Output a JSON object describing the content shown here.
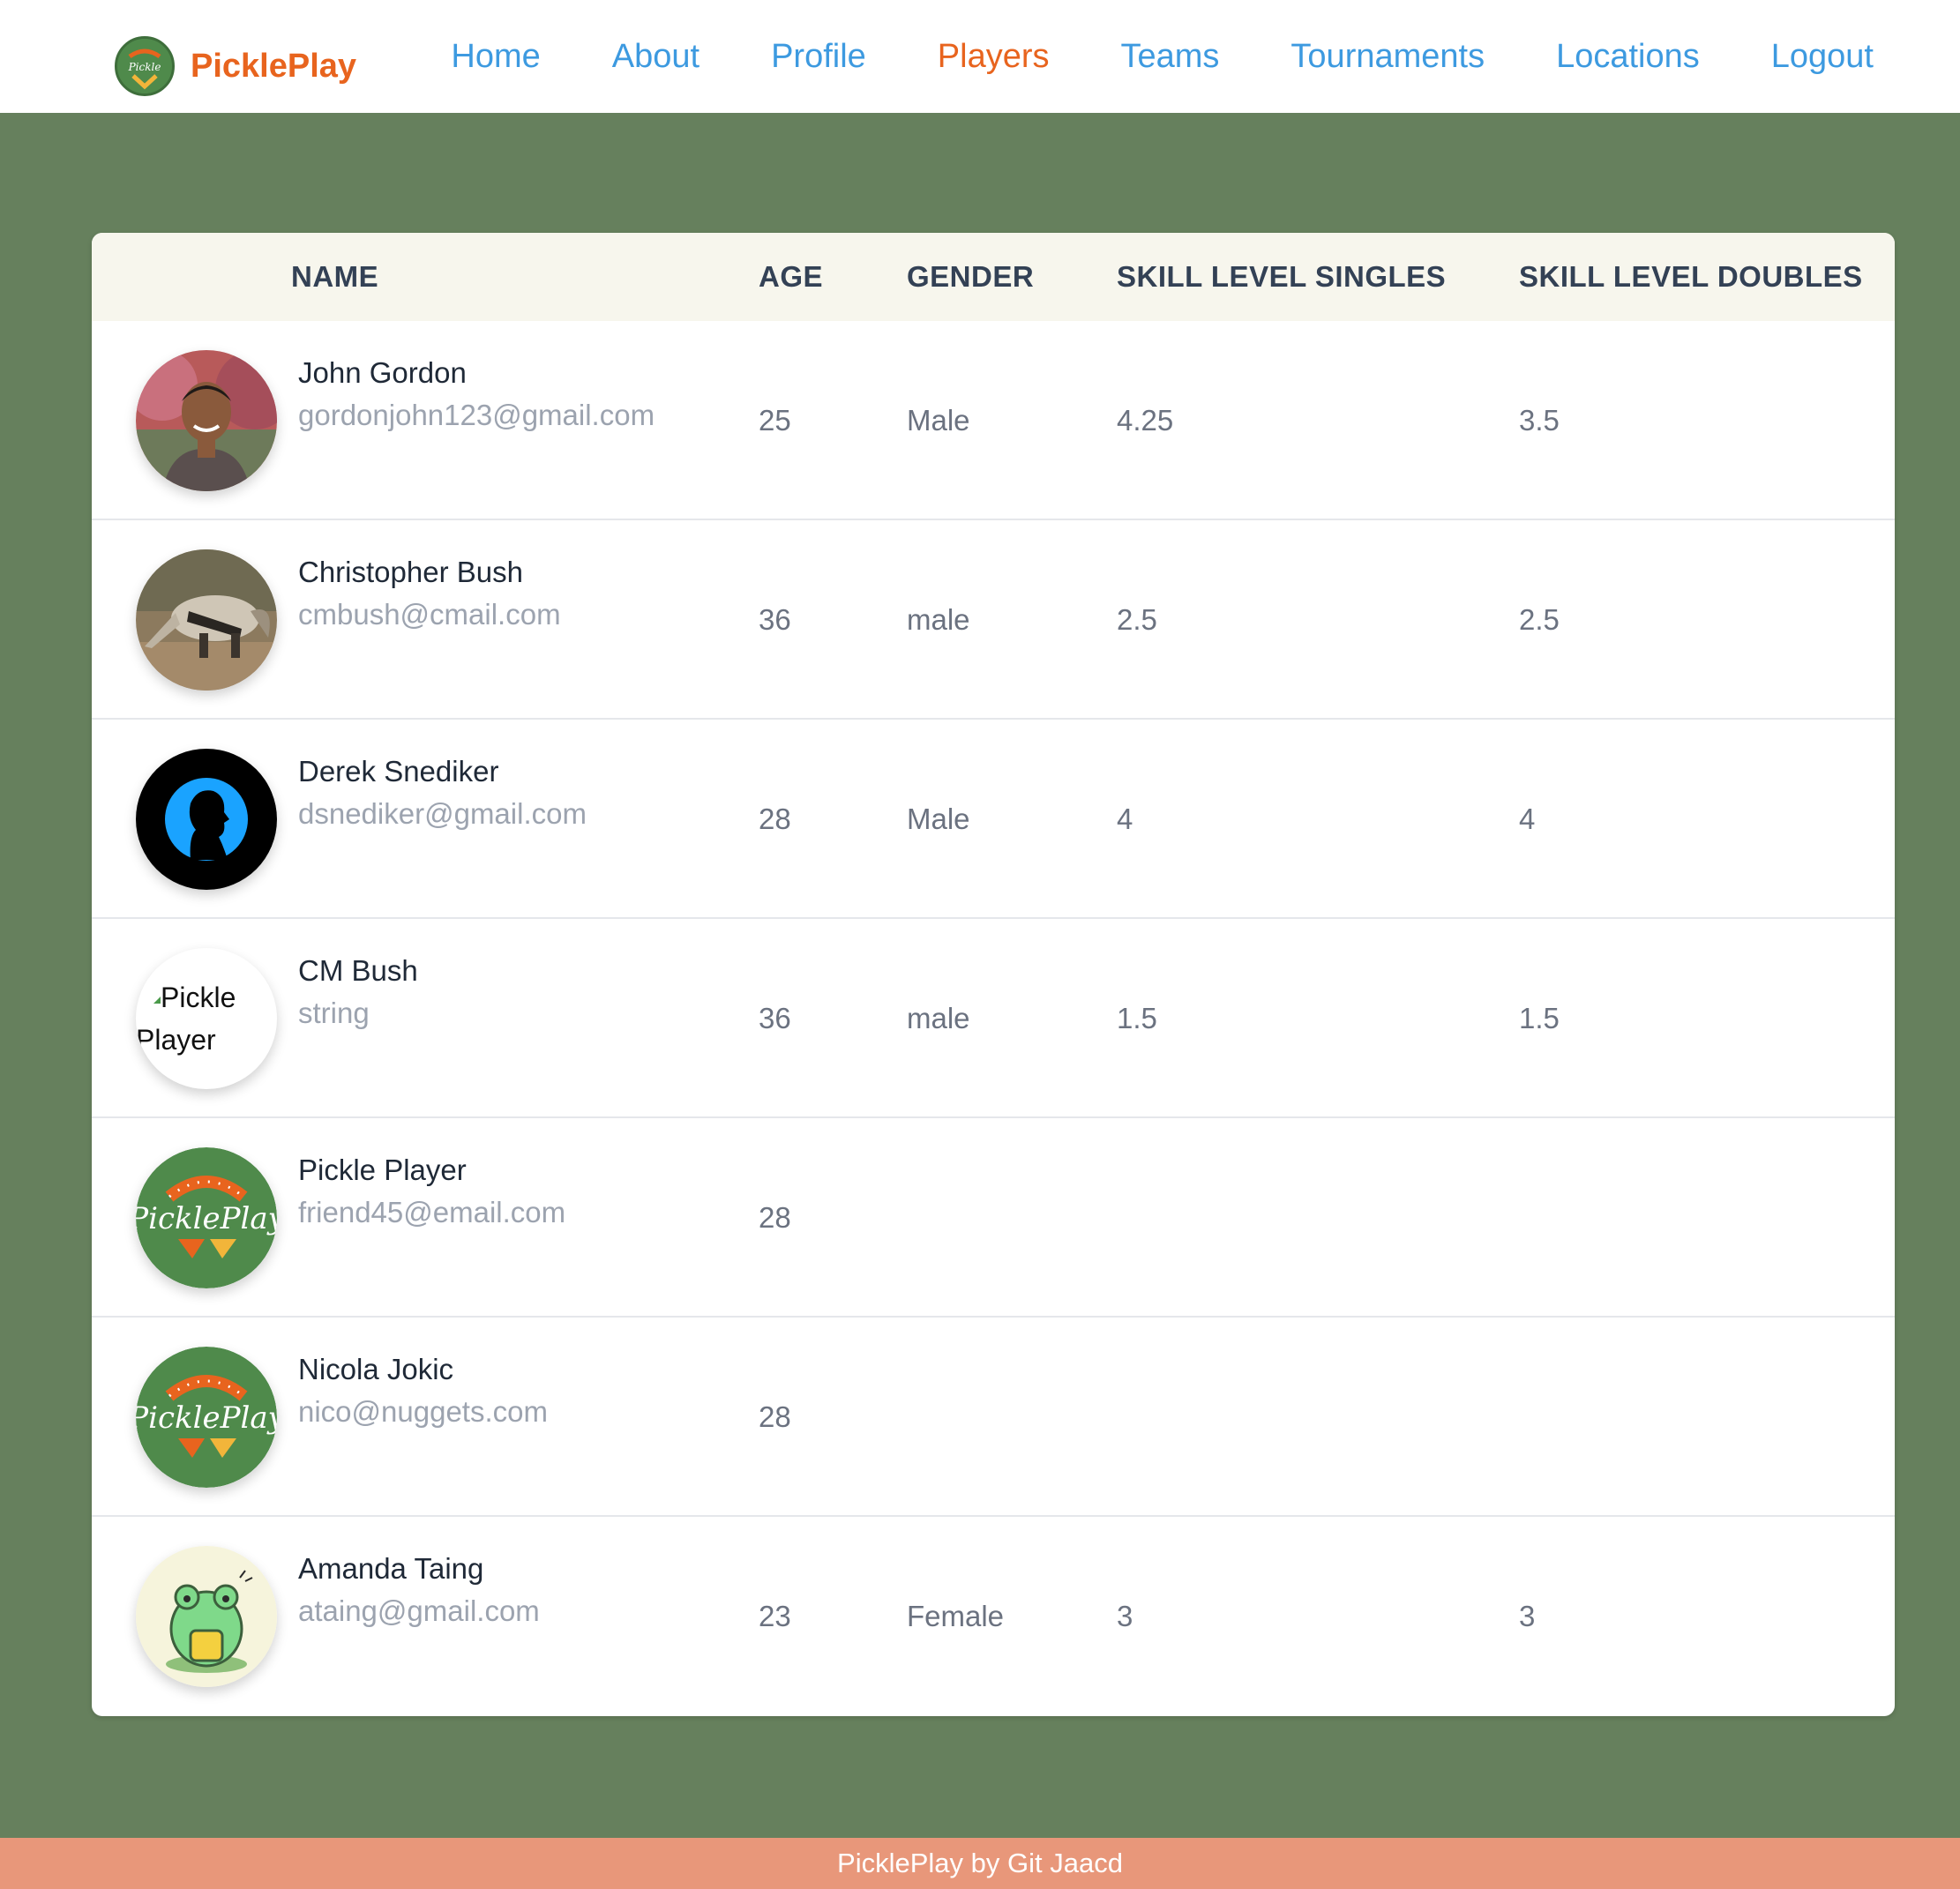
{
  "brand": {
    "name": "PicklePlay",
    "logo_icon": "pickleplay-logo-icon"
  },
  "nav": {
    "links": [
      {
        "label": "Home",
        "active": false
      },
      {
        "label": "About",
        "active": false
      },
      {
        "label": "Profile",
        "active": false
      },
      {
        "label": "Players",
        "active": true
      },
      {
        "label": "Teams",
        "active": false
      },
      {
        "label": "Tournaments",
        "active": false
      },
      {
        "label": "Locations",
        "active": false
      },
      {
        "label": "Logout",
        "active": false
      }
    ]
  },
  "table": {
    "headers": {
      "name": "NAME",
      "age": "AGE",
      "gender": "GENDER",
      "singles": "SKILL LEVEL SINGLES",
      "doubles": "SKILL LEVEL DOUBLES"
    },
    "rows": [
      {
        "name": "John Gordon",
        "email": "gordonjohn123@gmail.com",
        "age": "25",
        "gender": "Male",
        "singles": "4.25",
        "doubles": "3.5",
        "avatar": "photo-man-avatar"
      },
      {
        "name": "Christopher Bush",
        "email": "cmbush@cmail.com",
        "age": "36",
        "gender": "male",
        "singles": "2.5",
        "doubles": "2.5",
        "avatar": "anteater-avatar"
      },
      {
        "name": "Derek Snediker",
        "email": "dsnediker@gmail.com",
        "age": "28",
        "gender": "Male",
        "singles": "4",
        "doubles": "4",
        "avatar": "silhouette-avatar"
      },
      {
        "name": "CM Bush",
        "email": "string",
        "age": "36",
        "gender": "male",
        "singles": "1.5",
        "doubles": "1.5",
        "avatar": "broken-image-avatar",
        "alt_text": "Pickle Player"
      },
      {
        "name": "Pickle Player",
        "email": "friend45@email.com",
        "age": "28",
        "gender": "",
        "singles": "",
        "doubles": "",
        "avatar": "pickleplay-logo-avatar"
      },
      {
        "name": "Nicola Jokic",
        "email": "nico@nuggets.com",
        "age": "28",
        "gender": "",
        "singles": "",
        "doubles": "",
        "avatar": "pickleplay-logo-avatar"
      },
      {
        "name": "Amanda Taing",
        "email": "ataing@gmail.com",
        "age": "23",
        "gender": "Female",
        "singles": "3",
        "doubles": "3",
        "avatar": "frog-avatar"
      }
    ]
  },
  "footer": {
    "text": "PicklePlay by Git Jaacd"
  },
  "colors": {
    "page_bg": "#66805d",
    "brand_orange": "#e8641e",
    "nav_blue": "#3d9ae0",
    "header_bg": "#f7f6ed",
    "footer_bg": "#e8977a",
    "logo_green": "#4f8a4b"
  }
}
